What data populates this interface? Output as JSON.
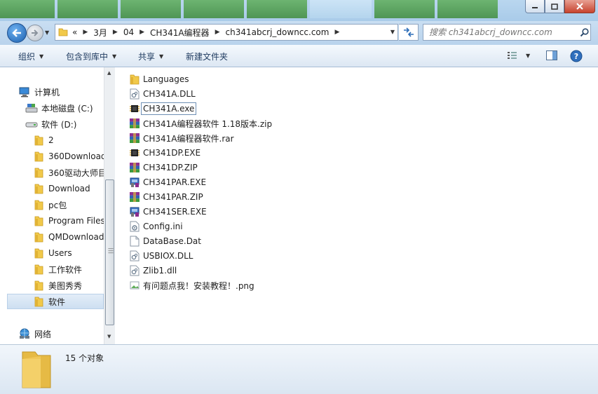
{
  "navigation": {
    "breadcrumb": [
      {
        "label": "«"
      },
      {
        "label": "3月"
      },
      {
        "label": "04"
      },
      {
        "label": "CH341A编程器"
      },
      {
        "label": "ch341abcrj_downcc.com"
      }
    ],
    "search_placeholder": "搜索 ch341abcrj_downcc.com"
  },
  "toolbar": {
    "organize": "组织",
    "include_in_library": "包含到库中",
    "share": "共享",
    "new_folder": "新建文件夹"
  },
  "nav_pane": {
    "items": [
      {
        "label": "计算机",
        "icon": "computer-icon"
      },
      {
        "label": "本地磁盘 (C:)",
        "icon": "system-drive-icon"
      },
      {
        "label": "软件 (D:)",
        "icon": "drive-icon"
      },
      {
        "label": "2",
        "icon": "folder-icon"
      },
      {
        "label": "360Download",
        "icon": "folder-icon"
      },
      {
        "label": "360驱动大师目",
        "icon": "folder-icon"
      },
      {
        "label": "Download",
        "icon": "folder-icon"
      },
      {
        "label": "pc包",
        "icon": "folder-icon"
      },
      {
        "label": "Program Files",
        "icon": "folder-icon"
      },
      {
        "label": "QMDownload",
        "icon": "folder-icon"
      },
      {
        "label": "Users",
        "icon": "folder-icon"
      },
      {
        "label": "工作软件",
        "icon": "folder-icon"
      },
      {
        "label": "美图秀秀",
        "icon": "folder-icon"
      },
      {
        "label": "软件",
        "icon": "folder-icon",
        "selected": true
      },
      {
        "label": "网络",
        "icon": "network-icon"
      }
    ]
  },
  "files": [
    {
      "name": "Languages",
      "icon": "folder-icon"
    },
    {
      "name": "CH341A.DLL",
      "icon": "dll-file-icon"
    },
    {
      "name": "CH341A.exe",
      "icon": "chip-exe-icon",
      "focused": true
    },
    {
      "name": "CH341A编程器软件 1.18版本.zip",
      "icon": "winrar-archive-icon"
    },
    {
      "name": "CH341A编程器软件.rar",
      "icon": "winrar-archive-icon"
    },
    {
      "name": "CH341DP.EXE",
      "icon": "chip-exe-icon"
    },
    {
      "name": "CH341DP.ZIP",
      "icon": "winrar-archive-icon"
    },
    {
      "name": "CH341PAR.EXE",
      "icon": "installer-exe-icon"
    },
    {
      "name": "CH341PAR.ZIP",
      "icon": "winrar-archive-icon"
    },
    {
      "name": "CH341SER.EXE",
      "icon": "installer-exe-icon"
    },
    {
      "name": "Config.ini",
      "icon": "ini-file-icon"
    },
    {
      "name": "DataBase.Dat",
      "icon": "generic-file-icon"
    },
    {
      "name": "USBIOX.DLL",
      "icon": "dll-file-icon"
    },
    {
      "name": "Zlib1.dll",
      "icon": "dll-file-icon"
    },
    {
      "name": "有问题点我！安装教程！.png",
      "icon": "image-file-icon"
    }
  ],
  "details": {
    "item_count": "15 个对象"
  },
  "colors": {
    "accent": "#2c6db8",
    "selection": "#cddff1",
    "folder": "#f1c94a"
  }
}
